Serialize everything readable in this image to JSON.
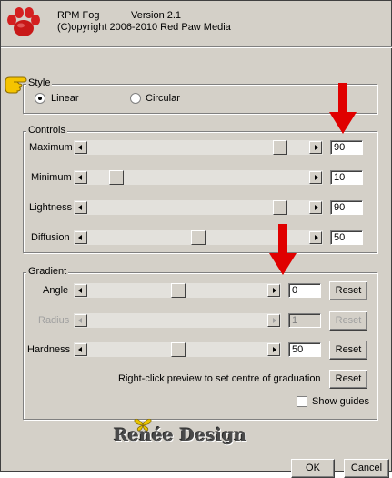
{
  "header": {
    "product": "RPM Fog",
    "version": "Version 2.1",
    "copyright": "(C)opyright 2006-2010 Red Paw Media"
  },
  "style": {
    "legend": "Style",
    "options": [
      {
        "label": "Linear",
        "selected": true
      },
      {
        "label": "Circular",
        "selected": false
      }
    ]
  },
  "controls": {
    "legend": "Controls",
    "sliders": [
      {
        "label": "Maximum",
        "value": "90"
      },
      {
        "label": "Minimum",
        "value": "10"
      },
      {
        "label": "Lightness",
        "value": "90"
      },
      {
        "label": "Diffusion",
        "value": "50"
      }
    ]
  },
  "gradient": {
    "legend": "Gradient",
    "sliders": [
      {
        "label": "Angle",
        "value": "0",
        "enabled": true,
        "reset": "Reset"
      },
      {
        "label": "Radius",
        "value": "1",
        "enabled": false,
        "reset": "Reset"
      },
      {
        "label": "Hardness",
        "value": "50",
        "enabled": true,
        "reset": "Reset"
      }
    ],
    "hint": "Right-click preview to set centre of graduation",
    "hint_reset": "Reset",
    "show_guides": "Show guides",
    "show_guides_checked": false
  },
  "watermark": "Renée Design",
  "footer": {
    "ok": "OK",
    "cancel": "Cancel"
  },
  "colors": {
    "dialog_bg": "#d4d0c8",
    "annotation_arrow": "#e00000",
    "logo_red": "#d42020"
  }
}
